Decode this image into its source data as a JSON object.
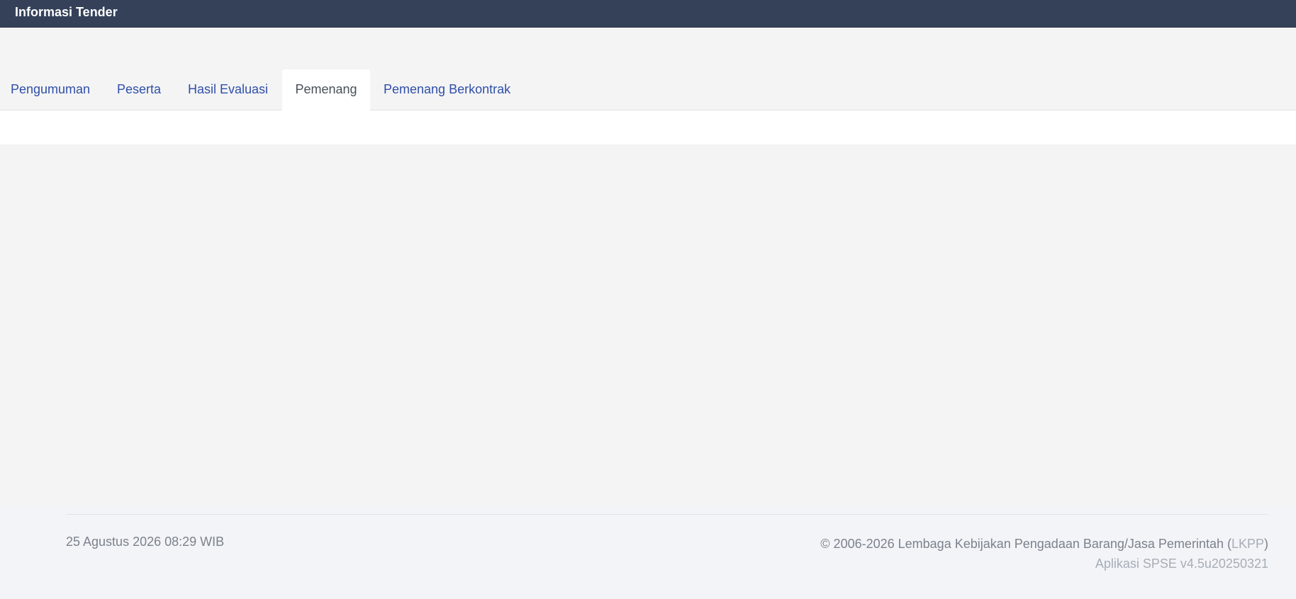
{
  "header": {
    "title": "Informasi Tender"
  },
  "tabs": [
    {
      "label": "Pengumuman",
      "active": false
    },
    {
      "label": "Peserta",
      "active": false
    },
    {
      "label": "Hasil Evaluasi",
      "active": false
    },
    {
      "label": "Pemenang",
      "active": true
    },
    {
      "label": "Pemenang Berkontrak",
      "active": false
    }
  ],
  "footer": {
    "datetime": "25 Agustus 2026 08:29 WIB",
    "copyright_prefix": "© 2006-2026 Lembaga Kebijakan Pengadaan Barang/Jasa Pemerintah (",
    "copyright_link": "LKPP",
    "copyright_suffix": ")",
    "version": "Aplikasi SPSE v4.5u20250321"
  },
  "colors": {
    "header_bg": "#344159",
    "tab_link": "#2f4fa8",
    "tab_active_text": "#495057",
    "page_bg": "#f4f4f5"
  }
}
